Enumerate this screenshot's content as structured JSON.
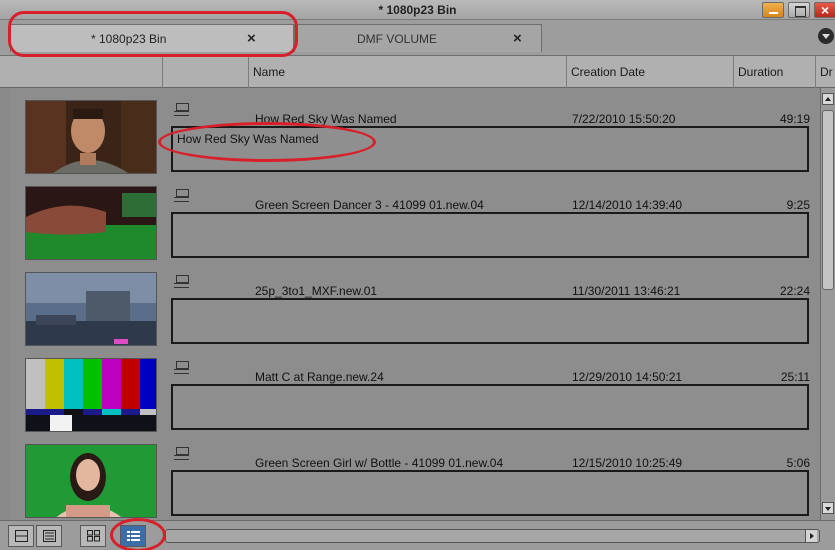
{
  "window": {
    "title": "* 1080p23 Bin"
  },
  "tabs": [
    {
      "label": "* 1080p23 Bin",
      "close": "×"
    },
    {
      "label": "DMF VOLUME",
      "close": "×"
    }
  ],
  "columns": [
    "",
    "",
    "Name",
    "Creation Date",
    "Duration",
    "Dr"
  ],
  "rows": [
    {
      "name": "How Red Sky Was Named",
      "date": "7/22/2010 15:50:20",
      "duration": "49:19",
      "comment": "How Red Sky Was Named"
    },
    {
      "name": "Green Screen Dancer 3 - 41099 01.new.04",
      "date": "12/14/2010 14:39:40",
      "duration": "9:25",
      "comment": ""
    },
    {
      "name": "25p_3to1_MXF.new.01",
      "date": "11/30/2011 13:46:21",
      "duration": "22:24",
      "comment": ""
    },
    {
      "name": "Matt C at Range.new.24",
      "date": "12/29/2010 14:50:21",
      "duration": "25:11",
      "comment": ""
    },
    {
      "name": "Green Screen Girl w/ Bottle - 41099 01.new.04",
      "date": "12/15/2010 10:25:49",
      "duration": "5:06",
      "comment": ""
    }
  ],
  "view_buttons": [
    "brief-view-icon",
    "text-view-icon",
    "frame-view-icon",
    "script-view-icon"
  ],
  "colors": {
    "annotation": "#d8202a",
    "active_view": "#3e6ea8"
  }
}
